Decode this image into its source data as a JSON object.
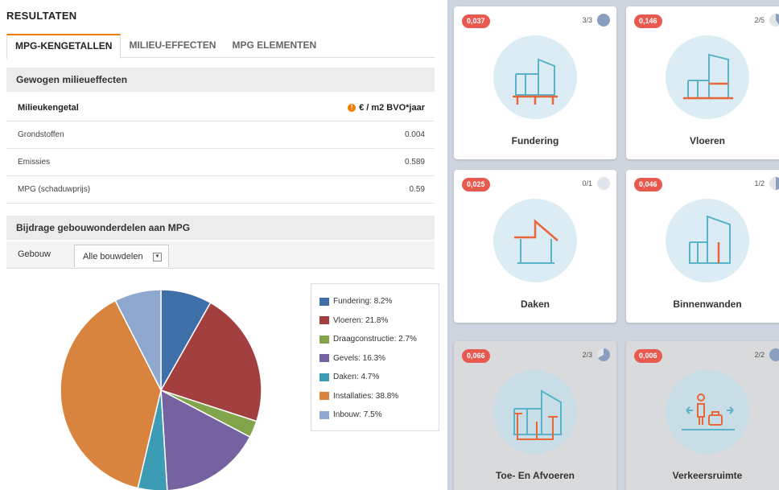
{
  "header": {
    "title": "RESULTATEN"
  },
  "tabs": [
    {
      "label": "MPG-KENGETALLEN",
      "active": true
    },
    {
      "label": "MILIEU-EFFECTEN",
      "active": false
    },
    {
      "label": "MPG ELEMENTEN",
      "active": false
    }
  ],
  "effects": {
    "heading": "Gewogen milieueffecten",
    "column_label": "Milieukengetal",
    "unit": "€ / m2 BVO*jaar",
    "info_icon": "!",
    "rows": [
      {
        "label": "Grondstoffen",
        "value": "0.004"
      },
      {
        "label": "Emissies",
        "value": "0.589"
      },
      {
        "label": "MPG (schaduwprijs)",
        "value": "0.59"
      }
    ]
  },
  "contribution": {
    "heading": "Bijdrage gebouwonderdelen aan MPG",
    "filter_label": "Gebouw",
    "filter_value": "Alle bouwdelen",
    "arrow_glyph": "▼"
  },
  "chart_data": {
    "type": "pie",
    "title": "",
    "slices": [
      {
        "label": "Fundering: 8.2%",
        "name": "Fundering",
        "value": 8.2,
        "color": "#3e6fa8"
      },
      {
        "label": "Vloeren: 21.8%",
        "name": "Vloeren",
        "value": 21.8,
        "color": "#a3403f"
      },
      {
        "label": "Draagconstructie: 2.7%",
        "name": "Draagconstructie",
        "value": 2.7,
        "color": "#82a54c"
      },
      {
        "label": "Gevels: 16.3%",
        "name": "Gevels",
        "value": 16.3,
        "color": "#7562a0"
      },
      {
        "label": "Daken: 4.7%",
        "name": "Daken",
        "value": 4.7,
        "color": "#3c9cb4"
      },
      {
        "label": "Installaties: 38.8%",
        "name": "Installaties",
        "value": 38.8,
        "color": "#d9843e"
      },
      {
        "label": "Inbouw: 7.5%",
        "name": "Inbouw",
        "value": 7.5,
        "color": "#8ea8cf"
      }
    ],
    "legend": "right"
  },
  "cards": [
    {
      "name": "Fundering",
      "score": "0,037",
      "count": "3/3",
      "progress": 1.0,
      "active": true,
      "icon": "foundation-icon"
    },
    {
      "name": "Vloeren",
      "score": "0,146",
      "count": "2/5",
      "progress": 0.4,
      "active": true,
      "icon": "floor-icon"
    },
    {
      "name": "Daken",
      "score": "0,025",
      "count": "0/1",
      "progress": 0.0,
      "active": true,
      "icon": "roof-icon"
    },
    {
      "name": "Binnenwanden",
      "score": "0,046",
      "count": "1/2",
      "progress": 0.5,
      "active": true,
      "icon": "inner-wall-icon"
    },
    {
      "name": "Toe- En Afvoeren",
      "score": "0,066",
      "count": "2/3",
      "progress": 0.667,
      "active": false,
      "icon": "pipes-icon"
    },
    {
      "name": "Verkeersruimte",
      "score": "0,006",
      "count": "2/2",
      "progress": 1.0,
      "active": false,
      "icon": "circulation-icon"
    }
  ],
  "colors": {
    "accent": "#f07d00",
    "badge": "#e85a4f",
    "icon_line": "#5ab4c8",
    "icon_highlight": "#e8673a",
    "progress": "#8a9fc0"
  }
}
